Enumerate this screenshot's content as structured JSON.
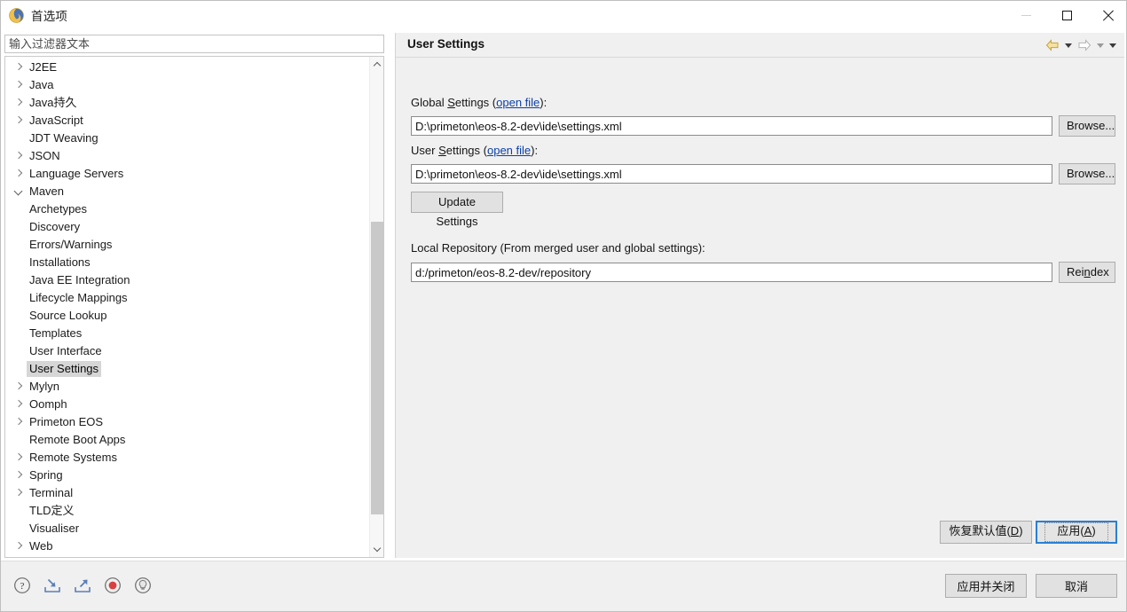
{
  "window": {
    "title": "首选项",
    "icon": "preferences-spiral-icon",
    "controls": {
      "minimize": "minimize-icon",
      "maximize": "maximize-icon",
      "close": "close-icon"
    }
  },
  "filter": {
    "placeholder": "输入过滤器文本",
    "value": ""
  },
  "tree": {
    "items": [
      {
        "label": "J2EE",
        "level": 0,
        "state": "collapsed",
        "selected": false
      },
      {
        "label": "Java",
        "level": 0,
        "state": "collapsed",
        "selected": false
      },
      {
        "label": "Java持久",
        "level": 0,
        "state": "collapsed",
        "selected": false
      },
      {
        "label": "JavaScript",
        "level": 0,
        "state": "collapsed",
        "selected": false
      },
      {
        "label": "JDT Weaving",
        "level": 0,
        "state": "leaf",
        "selected": false
      },
      {
        "label": "JSON",
        "level": 0,
        "state": "collapsed",
        "selected": false
      },
      {
        "label": "Language Servers",
        "level": 0,
        "state": "collapsed",
        "selected": false
      },
      {
        "label": "Maven",
        "level": 0,
        "state": "expanded",
        "selected": false
      },
      {
        "label": "Archetypes",
        "level": 1,
        "state": "leaf",
        "selected": false
      },
      {
        "label": "Discovery",
        "level": 1,
        "state": "leaf",
        "selected": false
      },
      {
        "label": "Errors/Warnings",
        "level": 1,
        "state": "leaf",
        "selected": false
      },
      {
        "label": "Installations",
        "level": 1,
        "state": "leaf",
        "selected": false
      },
      {
        "label": "Java EE Integration",
        "level": 1,
        "state": "leaf",
        "selected": false
      },
      {
        "label": "Lifecycle Mappings",
        "level": 1,
        "state": "leaf",
        "selected": false
      },
      {
        "label": "Source Lookup",
        "level": 1,
        "state": "leaf",
        "selected": false
      },
      {
        "label": "Templates",
        "level": 1,
        "state": "leaf",
        "selected": false
      },
      {
        "label": "User Interface",
        "level": 1,
        "state": "leaf",
        "selected": false
      },
      {
        "label": "User Settings",
        "level": 1,
        "state": "leaf",
        "selected": true
      },
      {
        "label": "Mylyn",
        "level": 0,
        "state": "collapsed",
        "selected": false
      },
      {
        "label": "Oomph",
        "level": 0,
        "state": "collapsed",
        "selected": false
      },
      {
        "label": "Primeton EOS",
        "level": 0,
        "state": "collapsed",
        "selected": false
      },
      {
        "label": "Remote Boot Apps",
        "level": 0,
        "state": "leaf",
        "selected": false
      },
      {
        "label": "Remote Systems",
        "level": 0,
        "state": "collapsed",
        "selected": false
      },
      {
        "label": "Spring",
        "level": 0,
        "state": "collapsed",
        "selected": false
      },
      {
        "label": "Terminal",
        "level": 0,
        "state": "collapsed",
        "selected": false
      },
      {
        "label": "TLD定义",
        "level": 0,
        "state": "leaf",
        "selected": false
      },
      {
        "label": "Visualiser",
        "level": 0,
        "state": "leaf",
        "selected": false
      },
      {
        "label": "Web",
        "level": 0,
        "state": "collapsed",
        "selected": false
      }
    ]
  },
  "panel": {
    "title": "User Settings",
    "nav": {
      "back_icon": "back-arrow-icon",
      "back_menu_icon": "chevron-down-icon",
      "forward_icon": "forward-arrow-icon",
      "forward_menu_icon": "chevron-down-icon",
      "view_menu_icon": "chevron-down-icon"
    },
    "global_settings": {
      "label_prefix": "Global ",
      "label_mnemonic": "S",
      "label_rest": "ettings (",
      "link": "open file",
      "label_suffix": "):",
      "value": "D:\\primeton\\eos-8.2-dev\\ide\\settings.xml",
      "browse": "Browse..."
    },
    "user_settings": {
      "label_prefix": "User ",
      "label_mnemonic": "S",
      "label_rest": "ettings (",
      "link": "open file",
      "label_suffix": "):",
      "value": "D:\\primeton\\eos-8.2-dev\\ide\\settings.xml",
      "browse": "Browse..."
    },
    "update_settings_button": "Update Settings",
    "local_repository": {
      "label": "Local Repository (From merged user and global settings):",
      "value": "d:/primeton/eos-8.2-dev/repository",
      "reindex_prefix": "Rei",
      "reindex_mnemonic": "n",
      "reindex_rest": "dex"
    },
    "restore_defaults": {
      "text": "恢复默认值(",
      "mnemonic": "D",
      "suffix": ")"
    },
    "apply": {
      "text": "应用(",
      "mnemonic": "A",
      "suffix": ")"
    }
  },
  "bottom": {
    "icons": [
      {
        "name": "help-icon"
      },
      {
        "name": "import-icon"
      },
      {
        "name": "export-icon"
      },
      {
        "name": "record-icon"
      },
      {
        "name": "lightbulb-icon"
      }
    ],
    "apply_and_close": "应用并关闭",
    "cancel": "取消"
  },
  "colors": {
    "window_bg": "#ffffff",
    "panel_bg": "#f0f0f0",
    "selection": "#d6d6d6",
    "link": "#0b3fa8",
    "focus_border": "#2a7fd4",
    "back_arrow": "#e8c85c",
    "record_red": "#d94040",
    "icon_blue": "#5b7fb5"
  }
}
